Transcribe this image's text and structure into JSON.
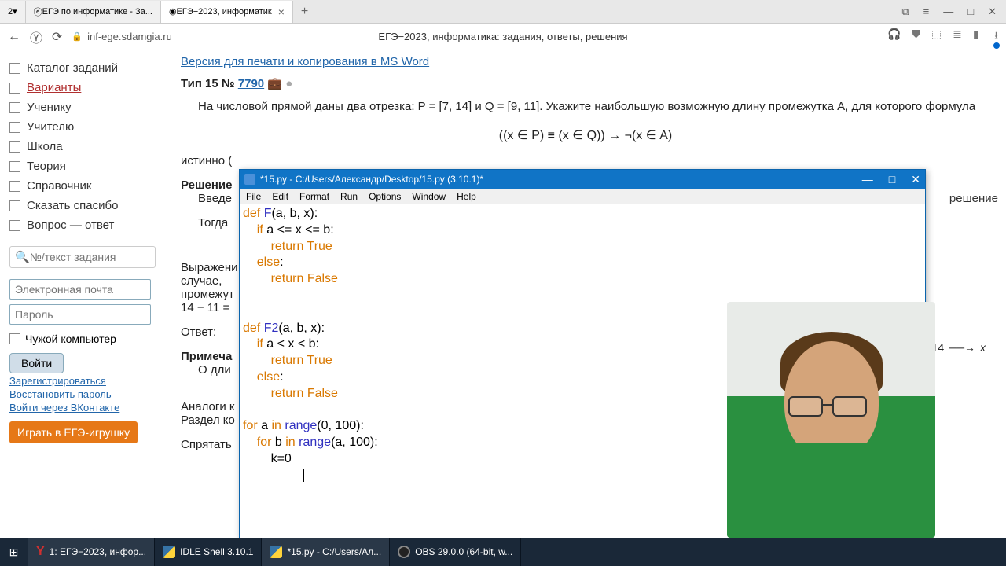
{
  "browser": {
    "tab_count": "2",
    "tab1": "ЕГЭ по информатике - За...",
    "tab2": "ЕГЭ−2023, информатик",
    "url": "inf-ege.sdamgia.ru",
    "page_title": "ЕГЭ−2023, информатика: задания, ответы, решения"
  },
  "sidebar": {
    "items": [
      "Каталог заданий",
      "Варианты",
      "Ученику",
      "Учителю",
      "Школа",
      "Теория",
      "Справочник",
      "Сказать спасибо",
      "Вопрос — ответ"
    ],
    "search_placeholder": "№/текст задания",
    "email_placeholder": "Электронная почта",
    "password_placeholder": "Пароль",
    "foreign_pc": "Чужой компьютер",
    "login_btn": "Войти",
    "register": "Зарегистрироваться",
    "restore": "Восстановить пароль",
    "vk": "Войти через ВКонтакте",
    "play": "Играть в ЕГЭ-игрушку"
  },
  "main": {
    "print_link": "Версия для печати и копирования в MS Word",
    "type_label": "Тип 15 № ",
    "task_num": "7790",
    "briefcase": "💼",
    "task_text": "На числовой прямой даны два отрезка: P = [7, 14] и Q = [9, 11]. Укажите наибольшую возможную длину промежутка A, для которого формула",
    "formula": "((x ∈ P) ≡ (x ∈ Q)) → ¬(x ∈ A)",
    "istinno": "истинно (",
    "reshenie": "Решение",
    "vved": "Введе",
    "togda": "Тогда",
    "vyrazh": "Выражени",
    "sluchae": "случае, ",
    "promezh": "промежут",
    "calc": "14 − 11 =",
    "otvet": "Ответ: ",
    "primecha": "Примеча",
    "odli": "О дли",
    "analogi": "Аналоги к",
    "razdel": "Раздел ко",
    "spryatat": "Спрятать",
    "answer_link": "решение",
    "x14": "14",
    "xlabel": "x"
  },
  "idle": {
    "title": "*15.py - C:/Users/Александр/Desktop/15.py (3.10.1)*",
    "menu": [
      "File",
      "Edit",
      "Format",
      "Run",
      "Options",
      "Window",
      "Help"
    ],
    "code": {
      "l1a": "def ",
      "l1b": "F",
      "l1c": "(a, b, x):",
      "l2a": "    if ",
      "l2b": "a <= x <= b:",
      "l3a": "        return ",
      "l3b": "True",
      "l4a": "    else",
      "l4b": ":",
      "l5a": "        return ",
      "l5b": "False",
      "l6": "",
      "l7a": "def ",
      "l7b": "F2",
      "l7c": "(a, b, x):",
      "l8a": "    if ",
      "l8b": "a < x < b:",
      "l9a": "        return ",
      "l9b": "True",
      "l10a": "    else",
      "l10b": ":",
      "l11a": "        return ",
      "l11b": "False",
      "l12": "",
      "l13a": "for ",
      "l13b": "a ",
      "l13c": "in ",
      "l13d": "range",
      "l13e": "(0, 100):",
      "l14a": "    for ",
      "l14b": "b ",
      "l14c": "in ",
      "l14d": "range",
      "l14e": "(a, 100):",
      "l15": "        k=0"
    }
  },
  "taskbar": {
    "yandex": "1: ЕГЭ−2023, инфор...",
    "idle_shell": "IDLE Shell 3.10.1",
    "idle_file": "*15.py - C:/Users/Ал...",
    "obs": "OBS 29.0.0 (64-bit, w..."
  }
}
